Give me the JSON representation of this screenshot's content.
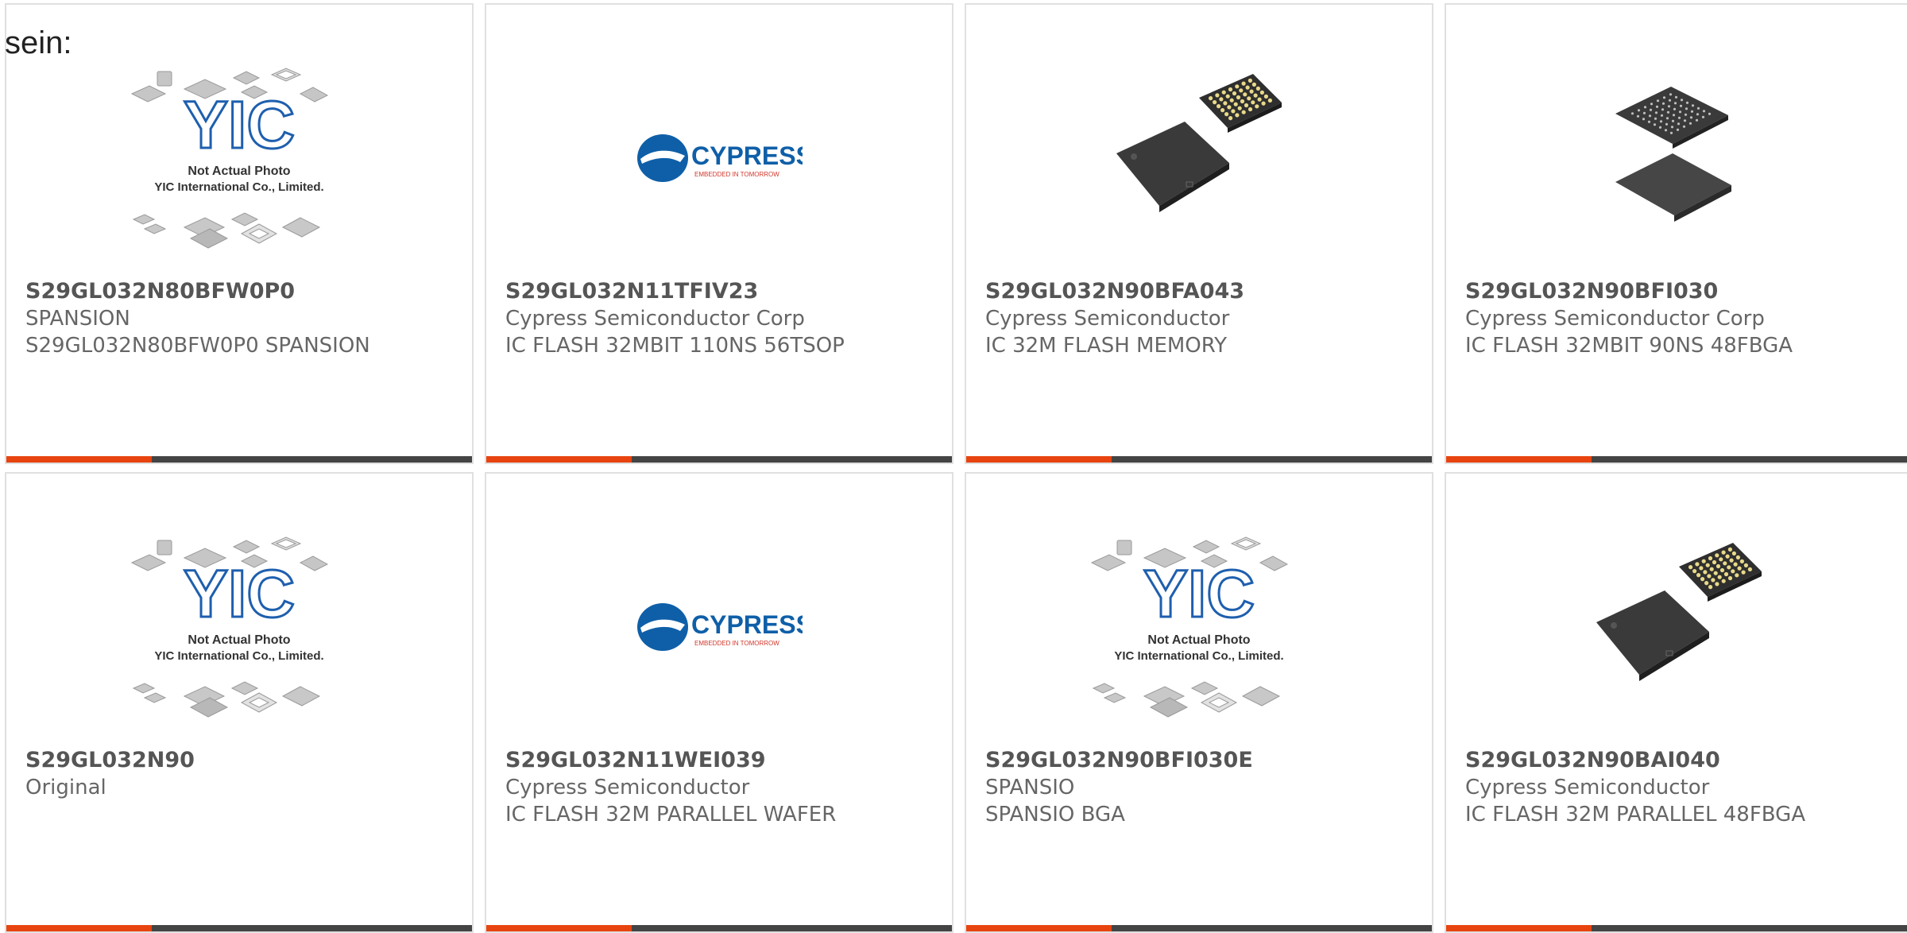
{
  "intro_text": "sein:",
  "colors": {
    "accent": "#e8440f",
    "bar_dark": "#444444",
    "card_border": "#e0e0e0"
  },
  "placeholder": {
    "line1": "Not Actual Photo",
    "line2": "YIC International Co., Limited.",
    "logo_text": "YIC"
  },
  "cypress": {
    "name": "CYPRESS",
    "tagline": "EMBEDDED IN TOMORROW"
  },
  "products": [
    {
      "part_number": "S29GL032N80BFW0P0",
      "manufacturer": "SPANSION",
      "description": "S29GL032N80BFW0P0 SPANSION",
      "image": "yic-placeholder"
    },
    {
      "part_number": "S29GL032N11TFIV23",
      "manufacturer": "Cypress Semiconductor Corp",
      "description": "IC FLASH 32MBIT 110NS 56TSOP",
      "image": "cypress-logo"
    },
    {
      "part_number": "S29GL032N90BFA043",
      "manufacturer": "Cypress Semiconductor",
      "description": "IC 32M FLASH MEMORY",
      "image": "bga-chip-photo"
    },
    {
      "part_number": "S29GL032N90BFI030",
      "manufacturer": "Cypress Semiconductor Corp",
      "description": "IC FLASH 32MBIT 90NS 48FBGA",
      "image": "bga-chip-photo"
    },
    {
      "part_number": "S29GL032N90",
      "manufacturer": "Original",
      "description": "",
      "image": "yic-placeholder"
    },
    {
      "part_number": "S29GL032N11WEI039",
      "manufacturer": "Cypress Semiconductor",
      "description": "IC FLASH 32M PARALLEL WAFER",
      "image": "cypress-logo"
    },
    {
      "part_number": "S29GL032N90BFI030E",
      "manufacturer": "SPANSIO",
      "description": "SPANSIO BGA",
      "image": "yic-placeholder"
    },
    {
      "part_number": "S29GL032N90BAI040",
      "manufacturer": "Cypress Semiconductor",
      "description": "IC FLASH 32M PARALLEL 48FBGA",
      "image": "bga-chip-photo"
    }
  ]
}
